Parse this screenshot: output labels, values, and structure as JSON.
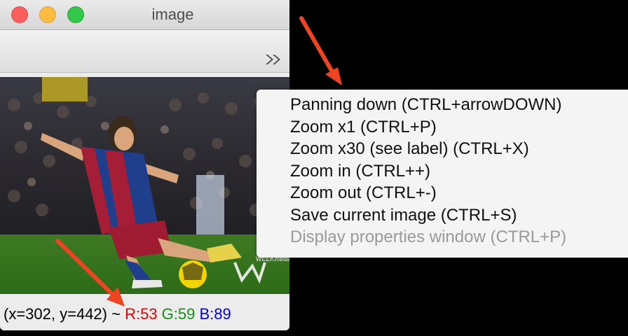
{
  "window": {
    "title": "image"
  },
  "toolbar": {
    "overflow_icon": "double-chevron-right"
  },
  "status": {
    "coords": "(x=302, y=442) ~ ",
    "r": "R:53",
    "g": "G:59",
    "b": "B:89",
    "colors": {
      "r": "#e60000",
      "g": "#1a8a1a",
      "b": "#0000e6"
    }
  },
  "image": {
    "watermark_text": "WEEKmedia"
  },
  "context_menu": {
    "items": [
      {
        "label": "Panning down (CTRL+arrowDOWN)",
        "enabled": true
      },
      {
        "label": "Zoom x1 (CTRL+P)",
        "enabled": true
      },
      {
        "label": "Zoom x30 (see label) (CTRL+X)",
        "enabled": true
      },
      {
        "label": "Zoom in (CTRL++)",
        "enabled": true
      },
      {
        "label": "Zoom out (CTRL+-)",
        "enabled": true
      },
      {
        "label": "Save current image (CTRL+S)",
        "enabled": true
      },
      {
        "label": "Display properties window (CTRL+P)",
        "enabled": false
      }
    ]
  },
  "annotations": {
    "arrow_color": "#ee4422"
  }
}
